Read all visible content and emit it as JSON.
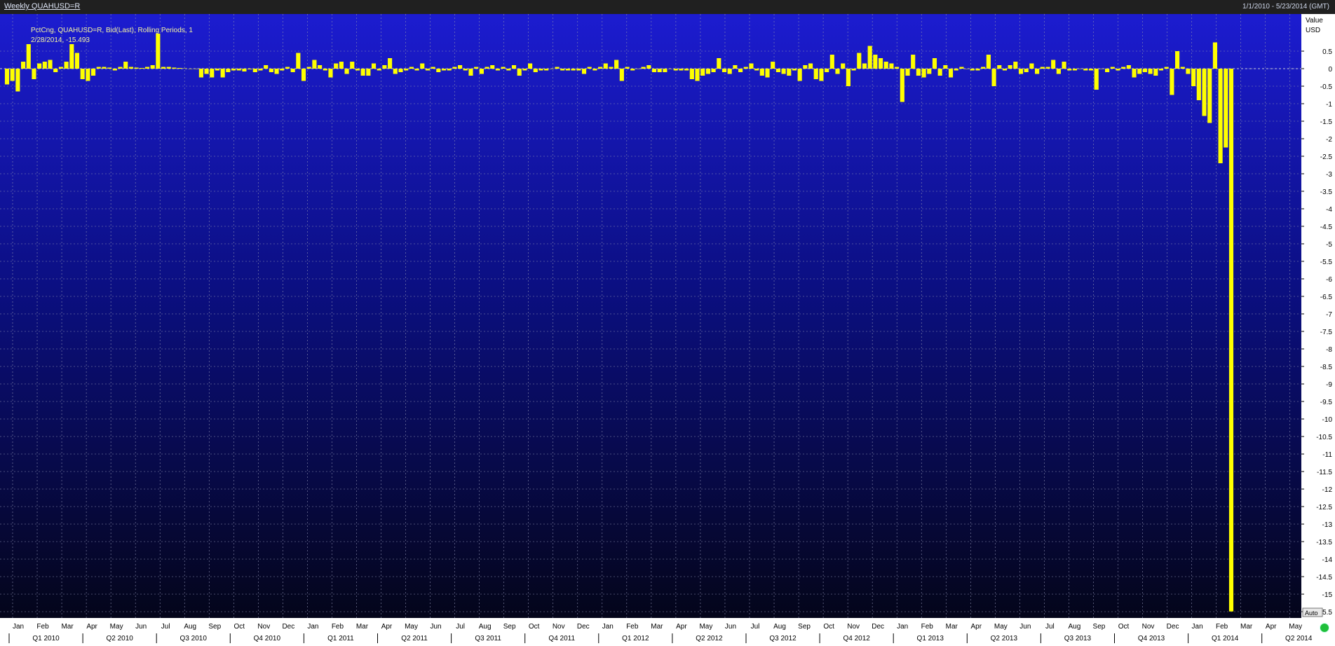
{
  "window": {
    "title": "Weekly QUAHUSD=R",
    "date_range": "1/1/2010 - 5/23/2014 (GMT)"
  },
  "legend": {
    "line1": "PctCng, QUAHUSD=R, Bid(Last), Rolling Periods, 1",
    "line2": "2/28/2014, -15.493"
  },
  "axis": {
    "y_label_top": "Value",
    "y_unit": "USD",
    "auto_button": "Auto"
  },
  "colors": {
    "bar": "#ffff00",
    "background_top": "#1c1cd0",
    "background_bottom": "#04051a",
    "grid": "#8c8fb0"
  },
  "chart_data": {
    "type": "bar",
    "ylim": [
      -15.5,
      0.5
    ],
    "y_ticks": [
      "0.5",
      "0",
      "-0.5",
      "-1",
      "-1.5",
      "-2",
      "-2.5",
      "-3",
      "-3.5",
      "-4",
      "-4.5",
      "-5",
      "-5.5",
      "-6",
      "-6.5",
      "-7",
      "-7.5",
      "-8",
      "-8.5",
      "-9",
      "-9.5",
      "-10",
      "-10.5",
      "-11",
      "-11.5",
      "-12",
      "-12.5",
      "-13",
      "-13.5",
      "-14",
      "-14.5",
      "-15",
      "-15.5"
    ],
    "x_start": "2010-01-01",
    "x_end": "2014-05-23",
    "months": [
      "Jan",
      "Feb",
      "Mar",
      "Apr",
      "May",
      "Jun",
      "Jul",
      "Aug",
      "Sep",
      "Oct",
      "Nov",
      "Dec",
      "Jan",
      "Feb",
      "Mar",
      "Apr",
      "May",
      "Jun",
      "Jul",
      "Aug",
      "Sep",
      "Oct",
      "Nov",
      "Dec",
      "Jan",
      "Feb",
      "Mar",
      "Apr",
      "May",
      "Jun",
      "Jul",
      "Aug",
      "Sep",
      "Oct",
      "Nov",
      "Dec",
      "Jan",
      "Feb",
      "Mar",
      "Apr",
      "May",
      "Jun",
      "Jul",
      "Aug",
      "Sep",
      "Oct",
      "Nov",
      "Dec",
      "Jan",
      "Feb",
      "Mar",
      "Apr",
      "May"
    ],
    "quarters": [
      "Q1 2010",
      "Q2 2010",
      "Q3 2010",
      "Q4 2010",
      "Q1 2011",
      "Q2 2011",
      "Q3 2011",
      "Q4 2011",
      "Q1 2012",
      "Q2 2012",
      "Q3 2012",
      "Q4 2012",
      "Q1 2013",
      "Q2 2013",
      "Q3 2013",
      "Q4 2013",
      "Q1 2014",
      "Q2 2014"
    ],
    "series": [
      {
        "values": [
          -0.45,
          -0.35,
          -0.65,
          0.2,
          0.7,
          -0.3,
          0.15,
          0.2,
          0.25,
          -0.1,
          0.05,
          0.2,
          0.7,
          0.45,
          -0.3,
          -0.35,
          -0.2,
          0.05,
          0.05,
          0.03,
          -0.05,
          0.05,
          0.2,
          0.05,
          0.03,
          0.02,
          0.05,
          0.1,
          1.0,
          0.05,
          0.05,
          0.03,
          0.02,
          0.01,
          0.0,
          0.0,
          -0.25,
          -0.15,
          -0.25,
          -0.05,
          -0.25,
          -0.1,
          -0.05,
          -0.05,
          -0.08,
          -0.02,
          -0.1,
          -0.05,
          0.1,
          -0.1,
          -0.15,
          -0.05,
          0.05,
          -0.1,
          0.45,
          -0.35,
          0.05,
          0.25,
          0.1,
          -0.05,
          -0.25,
          0.15,
          0.2,
          -0.15,
          0.2,
          -0.05,
          -0.2,
          -0.2,
          0.15,
          -0.05,
          0.1,
          0.3,
          -0.15,
          -0.1,
          -0.05,
          0.05,
          -0.05,
          0.15,
          -0.05,
          0.05,
          -0.1,
          -0.05,
          -0.05,
          0.05,
          0.1,
          -0.05,
          -0.2,
          0.05,
          -0.15,
          0.05,
          0.1,
          -0.05,
          0.05,
          -0.05,
          0.1,
          -0.2,
          -0.05,
          0.15,
          -0.1,
          -0.05,
          -0.05,
          0.0,
          0.05,
          -0.05,
          -0.05,
          -0.05,
          -0.05,
          -0.15,
          0.05,
          -0.05,
          0.05,
          0.15,
          0.05,
          0.25,
          -0.35,
          0.05,
          -0.05,
          0.0,
          0.05,
          0.1,
          -0.1,
          -0.1,
          -0.1,
          0.0,
          -0.05,
          -0.05,
          -0.05,
          -0.3,
          -0.35,
          -0.2,
          -0.15,
          -0.1,
          0.3,
          -0.1,
          -0.15,
          0.1,
          -0.1,
          0.05,
          0.15,
          -0.05,
          -0.2,
          -0.25,
          0.2,
          -0.1,
          -0.15,
          -0.2,
          -0.05,
          -0.35,
          0.1,
          0.15,
          -0.3,
          -0.35,
          -0.1,
          0.4,
          -0.15,
          0.15,
          -0.5,
          -0.05,
          0.45,
          0.15,
          0.65,
          0.4,
          0.3,
          0.2,
          0.15,
          0.05,
          -0.95,
          -0.2,
          0.4,
          -0.2,
          -0.25,
          -0.15,
          0.3,
          -0.2,
          0.1,
          -0.25,
          -0.05,
          0.05,
          0.0,
          -0.05,
          -0.05,
          0.05,
          0.4,
          -0.5,
          0.1,
          -0.05,
          0.1,
          0.2,
          -0.15,
          -0.1,
          0.15,
          -0.15,
          0.05,
          0.05,
          0.25,
          -0.15,
          0.2,
          -0.05,
          -0.05,
          0.0,
          -0.05,
          -0.05,
          -0.6,
          0.0,
          -0.1,
          0.05,
          -0.05,
          0.05,
          0.1,
          -0.25,
          -0.15,
          -0.1,
          -0.15,
          -0.2,
          -0.05,
          0.05,
          -0.75,
          0.5,
          0.05,
          -0.15,
          -0.5,
          -0.9,
          -1.35,
          -1.55,
          0.75,
          -2.7,
          -2.25,
          -15.493
        ]
      }
    ]
  }
}
